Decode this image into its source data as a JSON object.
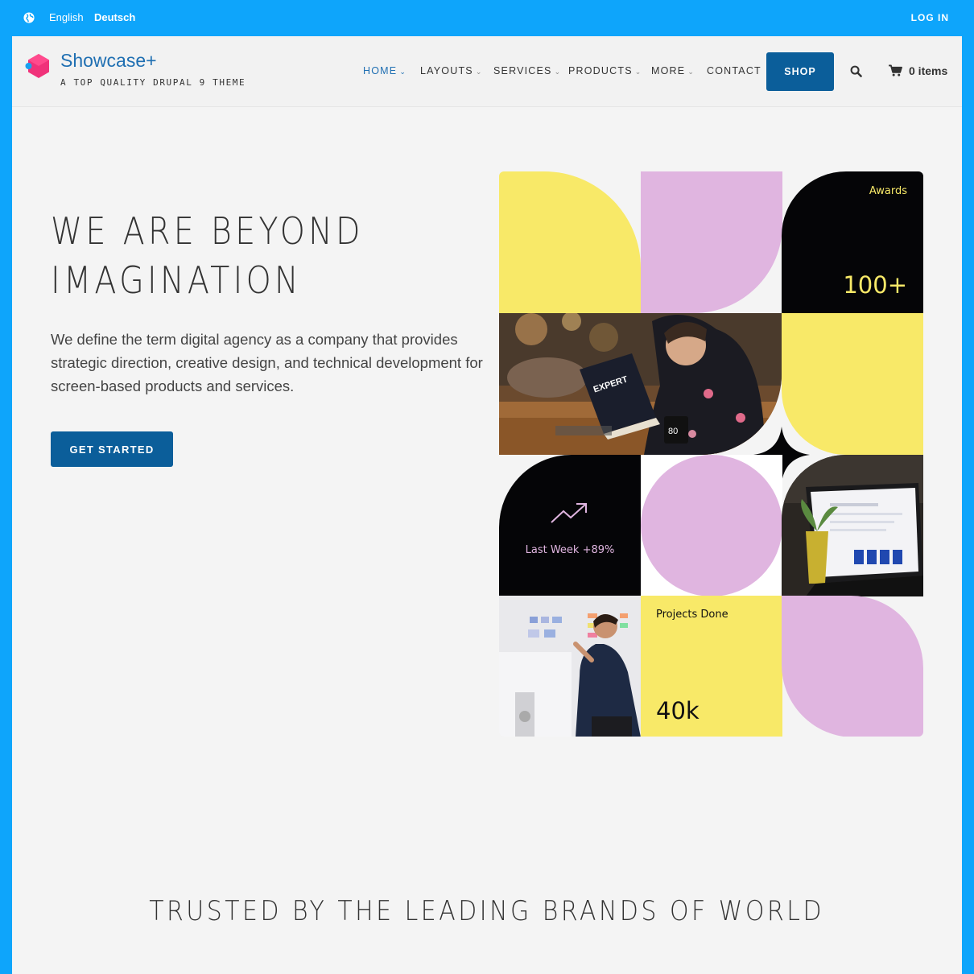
{
  "topbar": {
    "languages": [
      "English",
      "Deutsch"
    ],
    "login_label": "LOG IN"
  },
  "header": {
    "site_name": "Showcase+",
    "slogan": "A TOP QUALITY DRUPAL 9 THEME",
    "nav": [
      {
        "label": "HOME",
        "dropdown": true,
        "active": true
      },
      {
        "label": "LAYOUTS",
        "dropdown": true
      },
      {
        "label": "SERVICES",
        "dropdown": true
      },
      {
        "label": "PRODUCTS",
        "dropdown": true
      },
      {
        "label": "MORE",
        "dropdown": true
      },
      {
        "label": "CONTACT",
        "dropdown": false
      }
    ],
    "shop_label": "SHOP",
    "cart_label": "0 items"
  },
  "hero": {
    "title_line1": "WE ARE BEYOND",
    "title_line2": "IMAGINATION",
    "text": "We define the term digital agency as a company that provides strategic direction, creative design, and technical development for screen-based products and services.",
    "cta_label": "GET STARTED"
  },
  "collage": {
    "awards_label": "Awards",
    "awards_value": "100+",
    "last_week_label": "Last Week +89%",
    "projects_label": "Projects Done",
    "projects_value": "40k",
    "colors": {
      "yellow": "#f8e968",
      "pink": "#e0b5e0",
      "black": "#050507"
    }
  },
  "trusted": {
    "heading": "TRUSTED BY THE LEADING BRANDS OF WORLD"
  },
  "colors": {
    "frame": "#0ea5fb",
    "primary": "#0b5e9a",
    "link": "#1f6fb2",
    "background": "#f4f4f4"
  }
}
